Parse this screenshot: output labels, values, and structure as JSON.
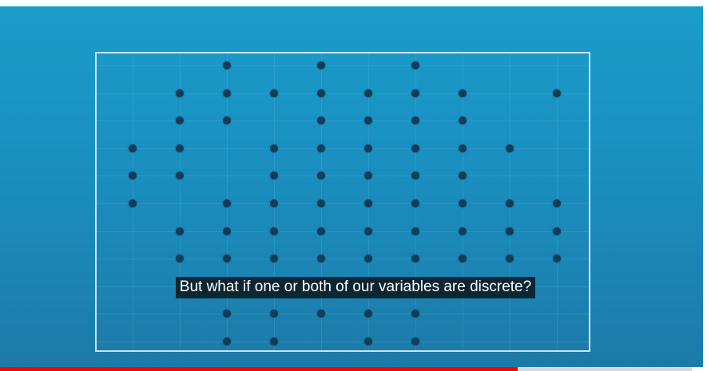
{
  "caption": {
    "text": "But what if one or both of our variables are discrete?"
  },
  "plot": {
    "columns": [
      1,
      2,
      3,
      4,
      5,
      6,
      7,
      8,
      9,
      10
    ],
    "rows": [
      1,
      2,
      3,
      4,
      5,
      6,
      7,
      8,
      9,
      10,
      11
    ],
    "points": [
      [
        3,
        1
      ],
      [
        5,
        1
      ],
      [
        7,
        1
      ],
      [
        2,
        2
      ],
      [
        3,
        2
      ],
      [
        4,
        2
      ],
      [
        5,
        2
      ],
      [
        6,
        2
      ],
      [
        7,
        2
      ],
      [
        8,
        2
      ],
      [
        10,
        2
      ],
      [
        2,
        3
      ],
      [
        3,
        3
      ],
      [
        5,
        3
      ],
      [
        6,
        3
      ],
      [
        7,
        3
      ],
      [
        8,
        3
      ],
      [
        1,
        4
      ],
      [
        2,
        4
      ],
      [
        4,
        4
      ],
      [
        5,
        4
      ],
      [
        6,
        4
      ],
      [
        7,
        4
      ],
      [
        8,
        4
      ],
      [
        9,
        4
      ],
      [
        1,
        5
      ],
      [
        2,
        5
      ],
      [
        4,
        5
      ],
      [
        5,
        5
      ],
      [
        6,
        5
      ],
      [
        7,
        5
      ],
      [
        8,
        5
      ],
      [
        1,
        6
      ],
      [
        3,
        6
      ],
      [
        4,
        6
      ],
      [
        5,
        6
      ],
      [
        6,
        6
      ],
      [
        7,
        6
      ],
      [
        8,
        6
      ],
      [
        9,
        6
      ],
      [
        10,
        6
      ],
      [
        2,
        7
      ],
      [
        3,
        7
      ],
      [
        4,
        7
      ],
      [
        5,
        7
      ],
      [
        6,
        7
      ],
      [
        7,
        7
      ],
      [
        8,
        7
      ],
      [
        9,
        7
      ],
      [
        10,
        7
      ],
      [
        2,
        8
      ],
      [
        3,
        8
      ],
      [
        4,
        8
      ],
      [
        5,
        8
      ],
      [
        6,
        8
      ],
      [
        7,
        8
      ],
      [
        8,
        8
      ],
      [
        9,
        8
      ],
      [
        10,
        8
      ],
      [
        3,
        9
      ],
      [
        5,
        9
      ],
      [
        6,
        9
      ],
      [
        8,
        9
      ],
      [
        3,
        10
      ],
      [
        4,
        10
      ],
      [
        5,
        10
      ],
      [
        6,
        10
      ],
      [
        7,
        10
      ],
      [
        3,
        11
      ],
      [
        4,
        11
      ],
      [
        6,
        11
      ],
      [
        7,
        11
      ]
    ]
  },
  "progress": {
    "fraction": 0.748
  },
  "colors": {
    "background_top": "#1a9cc9",
    "background_bottom": "#1c7aa8",
    "dot": "#123c58",
    "frame": "#ebf5fa",
    "progress": "#ff0000"
  }
}
